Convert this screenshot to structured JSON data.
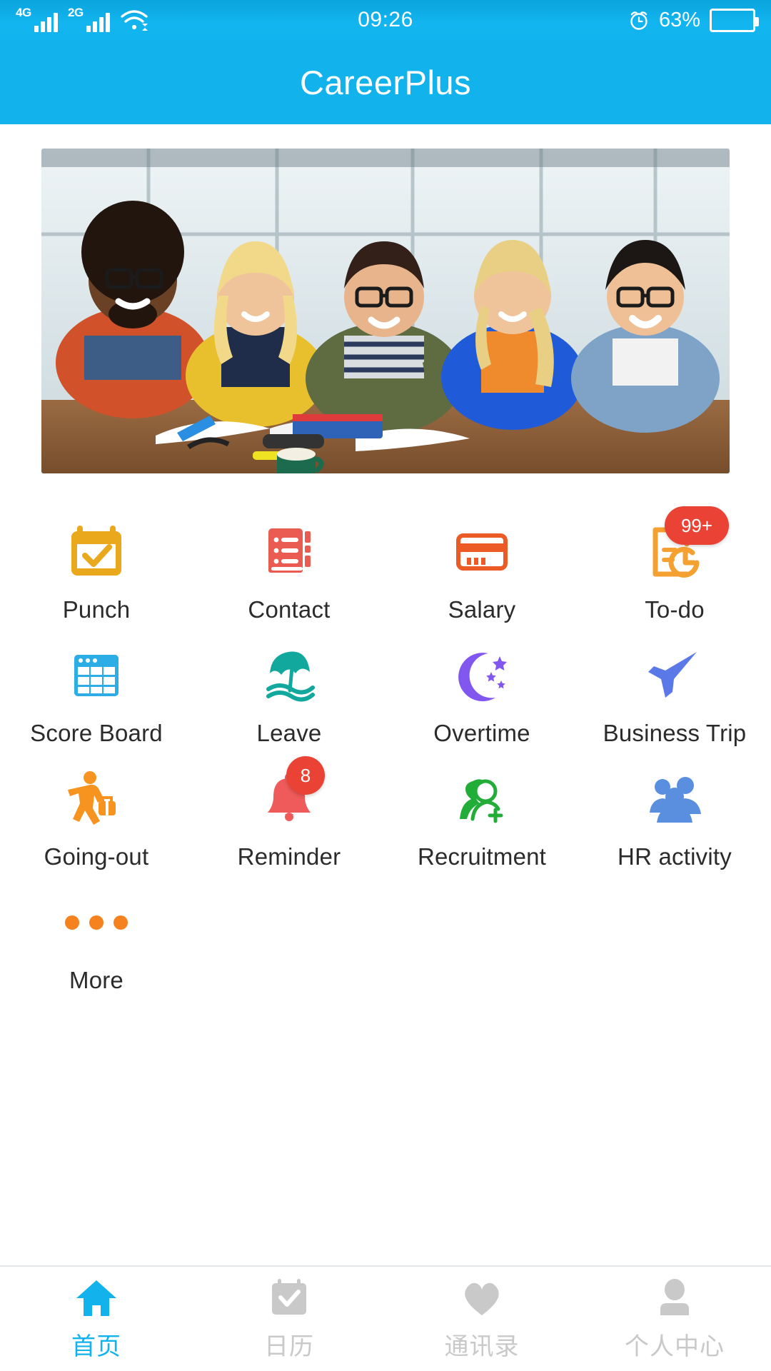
{
  "statusbar": {
    "signal_1_label": "4G",
    "signal_2_label": "2G",
    "wifi_icon": "wifi-icon",
    "time": "09:26",
    "alarm_icon": "alarm-clock-icon",
    "battery_percent": "63%",
    "battery_level": 63
  },
  "header": {
    "title": "CareerPlus"
  },
  "banner": {
    "alt": "five smiling colleagues at a table with books"
  },
  "grid": {
    "items": [
      {
        "label": "Punch",
        "icon": "calendar-check-icon",
        "color": "#eaa81d",
        "badge": null
      },
      {
        "label": "Contact",
        "icon": "address-book-icon",
        "color": "#ea5b52",
        "badge": null
      },
      {
        "label": "Salary",
        "icon": "credit-card-icon",
        "color": "#ec5a26",
        "badge": null
      },
      {
        "label": "To-do",
        "icon": "task-clock-icon",
        "color": "#f5a132",
        "badge": "99+"
      },
      {
        "label": "Score Board",
        "icon": "spreadsheet-icon",
        "color": "#2cade6",
        "badge": null
      },
      {
        "label": "Leave",
        "icon": "beach-umbrella-icon",
        "color": "#13a89e",
        "badge": null
      },
      {
        "label": "Overtime",
        "icon": "moon-stars-icon",
        "color": "#8257ef",
        "badge": null
      },
      {
        "label": "Business Trip",
        "icon": "airplane-icon",
        "color": "#5a78e8",
        "badge": null
      },
      {
        "label": "Going-out",
        "icon": "traveler-icon",
        "color": "#f79420",
        "badge": null
      },
      {
        "label": "Reminder",
        "icon": "bell-icon",
        "color": "#ef5a5a",
        "badge": "8"
      },
      {
        "label": "Recruitment",
        "icon": "person-add-icon",
        "color": "#22ac38",
        "badge": null
      },
      {
        "label": "HR activity",
        "icon": "people-group-icon",
        "color": "#5a8fe0",
        "badge": null
      },
      {
        "label": "More",
        "icon": "ellipsis-icon",
        "color": "#f5821f",
        "badge": null
      }
    ]
  },
  "tabbar": {
    "items": [
      {
        "label": "首页",
        "icon": "home-icon",
        "active": true
      },
      {
        "label": "日历",
        "icon": "calendar-check-icon",
        "active": false
      },
      {
        "label": "通讯录",
        "icon": "heart-icon",
        "active": false
      },
      {
        "label": "个人中心",
        "icon": "person-icon",
        "active": false
      }
    ]
  },
  "colors": {
    "brand": "#12b3ec",
    "statusbar": "#0fa9e4",
    "badge": "#ea4335",
    "tab_active": "#12b3ec",
    "tab_inactive": "#c9c9c9"
  }
}
